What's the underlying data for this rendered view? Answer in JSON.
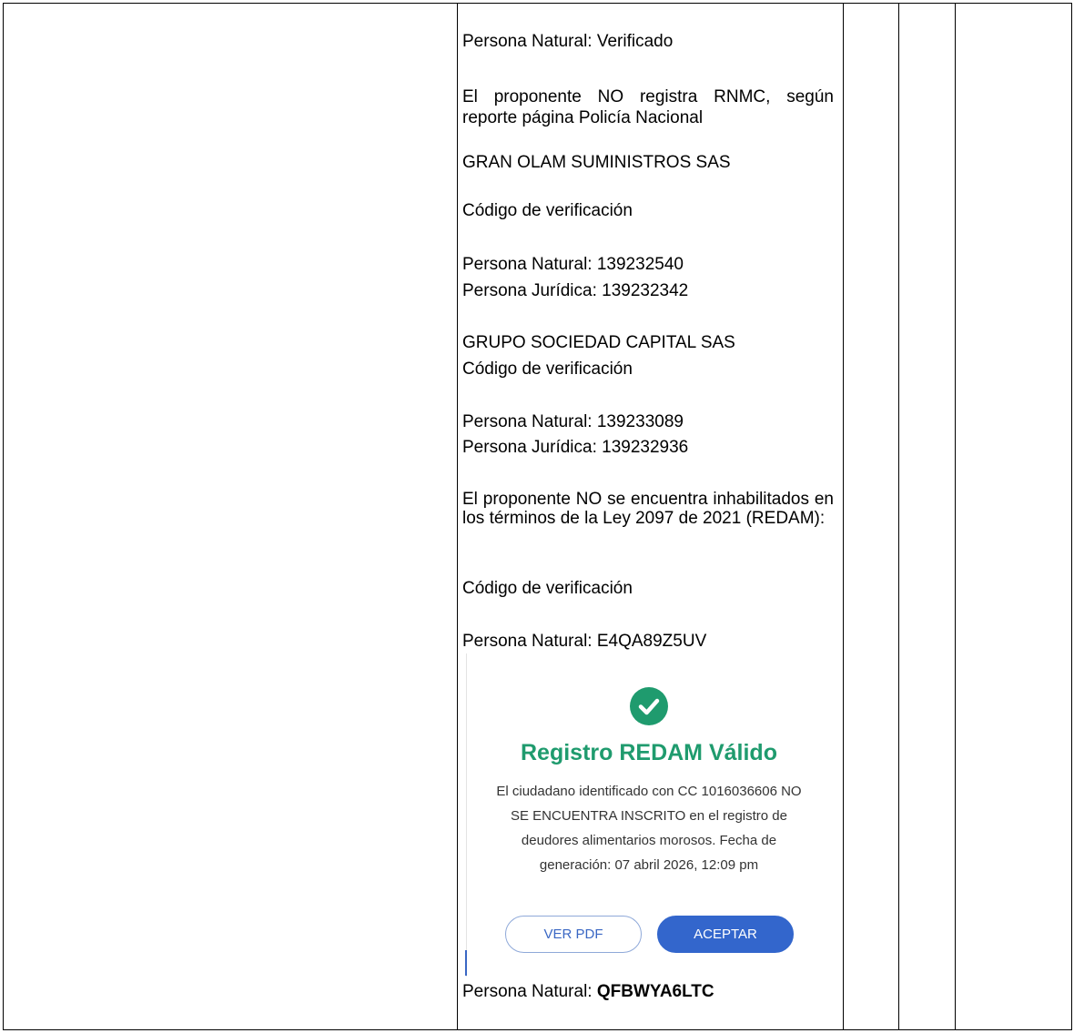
{
  "lines": {
    "verificado": "Persona Natural: Verificado",
    "rnmc": "El proponente NO registra RNMC, según reporte página Policía Nacional",
    "company1": "GRAN OLAM SUMINISTROS SAS",
    "code_label1": "Código de verificación",
    "pn1": "Persona Natural:  139232540",
    "pj1": "Persona Jurídica: 139232342",
    "company2": "GRUPO SOCIEDAD CAPITAL SAS",
    "code_label2": "Código de verificación",
    "pn2": "Persona Natural:  139233089",
    "pj2": "Persona Jurídica: 139232936",
    "redam_statement": "El proponente NO se encuentra inhabilitados en los términos de la Ley 2097 de 2021 (REDAM):",
    "code_label3": "Código de verificación",
    "pn3": "Persona Natural: E4QA89Z5UV",
    "pn4_label": "Persona Natural: ",
    "pn4_code": "QFBWYA6LTC"
  },
  "redam": {
    "icon": "check-circle-icon",
    "title": "Registro REDAM Válido",
    "message": "El ciudadano identificado con CC 1016036606 NO SE ENCUENTRA INSCRITO en el registro de deudores alimentarios morosos. Fecha de generación: 07 abril 2026, 12:09 pm",
    "btn_pdf": "VER PDF",
    "btn_accept": "ACEPTAR",
    "colors": {
      "accent_green": "#1f9b6e",
      "accent_blue": "#3366cc"
    }
  }
}
